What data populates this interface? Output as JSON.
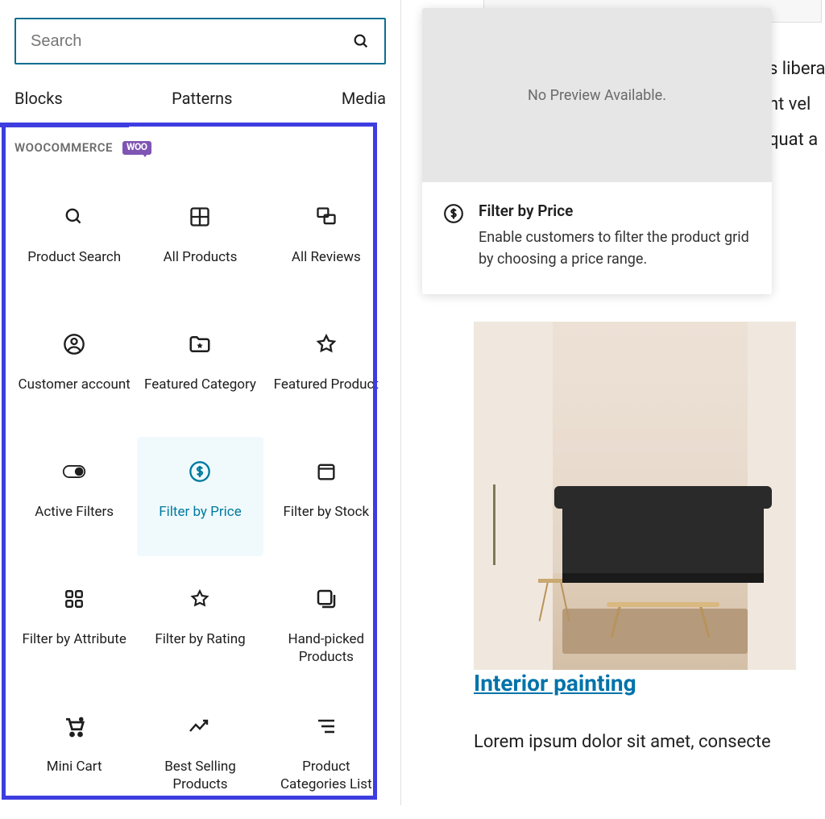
{
  "search": {
    "placeholder": "Search"
  },
  "tabs": {
    "blocks": "Blocks",
    "patterns": "Patterns",
    "media": "Media"
  },
  "section": {
    "title": "WOOCOMMERCE",
    "badge": "Woo"
  },
  "blocks": [
    {
      "id": "product-search",
      "label": "Product Search"
    },
    {
      "id": "all-products",
      "label": "All Products"
    },
    {
      "id": "all-reviews",
      "label": "All Reviews"
    },
    {
      "id": "customer-account",
      "label": "Customer account"
    },
    {
      "id": "featured-category",
      "label": "Featured Category"
    },
    {
      "id": "featured-product",
      "label": "Featured Product"
    },
    {
      "id": "active-filters",
      "label": "Active Filters"
    },
    {
      "id": "filter-by-price",
      "label": "Filter by Price",
      "selected": true
    },
    {
      "id": "filter-by-stock",
      "label": "Filter by Stock"
    },
    {
      "id": "filter-by-attribute",
      "label": "Filter by Attribute"
    },
    {
      "id": "filter-by-rating",
      "label": "Filter by Rating"
    },
    {
      "id": "hand-picked-products",
      "label": "Hand-picked Products"
    },
    {
      "id": "mini-cart",
      "label": "Mini Cart"
    },
    {
      "id": "best-selling-products",
      "label": "Best Selling Products"
    },
    {
      "id": "product-categories-list",
      "label": "Product Categories List"
    }
  ],
  "tooltip": {
    "preview": "No Preview Available.",
    "title": "Filter by Price",
    "desc": "Enable customers to filter the product grid by choosing a price range."
  },
  "bgtext": {
    "l1": "s libera",
    "l2": "nt vel",
    "l3": "quat a"
  },
  "post": {
    "title": "Interior painting",
    "body": "Lorem ipsum dolor sit amet, consecte"
  }
}
